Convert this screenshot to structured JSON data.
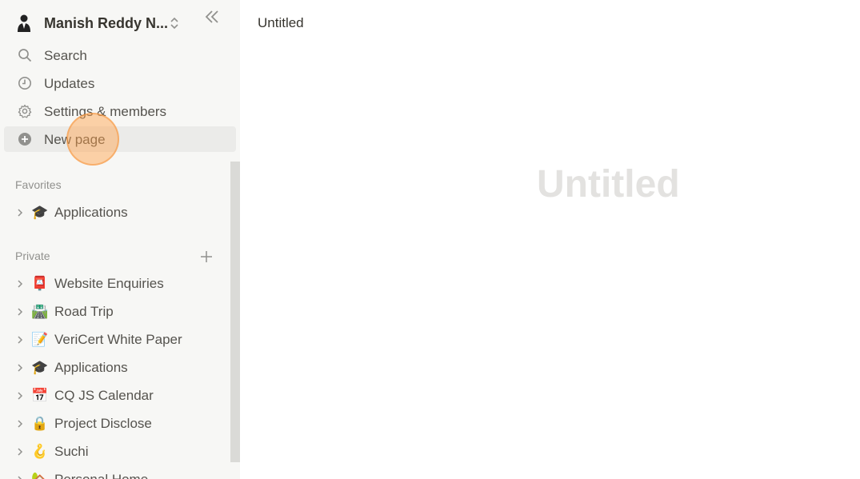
{
  "workspace": {
    "name": "Manish Reddy N..."
  },
  "nav": {
    "items": [
      {
        "label": "Search",
        "icon": "search-icon"
      },
      {
        "label": "Updates",
        "icon": "clock-icon"
      },
      {
        "label": "Settings & members",
        "icon": "gear-icon"
      },
      {
        "label": "New page",
        "icon": "plus-circle-icon"
      }
    ]
  },
  "favorites": {
    "label": "Favorites",
    "items": [
      {
        "emoji": "🎓",
        "label": "Applications"
      }
    ]
  },
  "private": {
    "label": "Private",
    "items": [
      {
        "emoji": "📮",
        "label": "Website Enquiries"
      },
      {
        "emoji": "🛣️",
        "label": "Road Trip"
      },
      {
        "emoji": "📝",
        "label": "VeriCert White Paper"
      },
      {
        "emoji": "🎓",
        "label": "Applications"
      },
      {
        "emoji": "📅",
        "label": "CQ JS Calendar"
      },
      {
        "emoji": "🔒",
        "label": "Project Disclose"
      },
      {
        "emoji": "🪝",
        "label": "Suchi"
      },
      {
        "emoji": "🏡",
        "label": "Personal Home"
      }
    ]
  },
  "main": {
    "breadcrumb": "Untitled",
    "title_placeholder": "Untitled"
  },
  "colors": {
    "sidebar_bg": "#f7f7f5",
    "active_item_bg": "#ebebe9",
    "text": "#37352f",
    "muted_text": "#91918e",
    "placeholder_title": "#e3e2e0",
    "click_marker": "#ffa046"
  }
}
